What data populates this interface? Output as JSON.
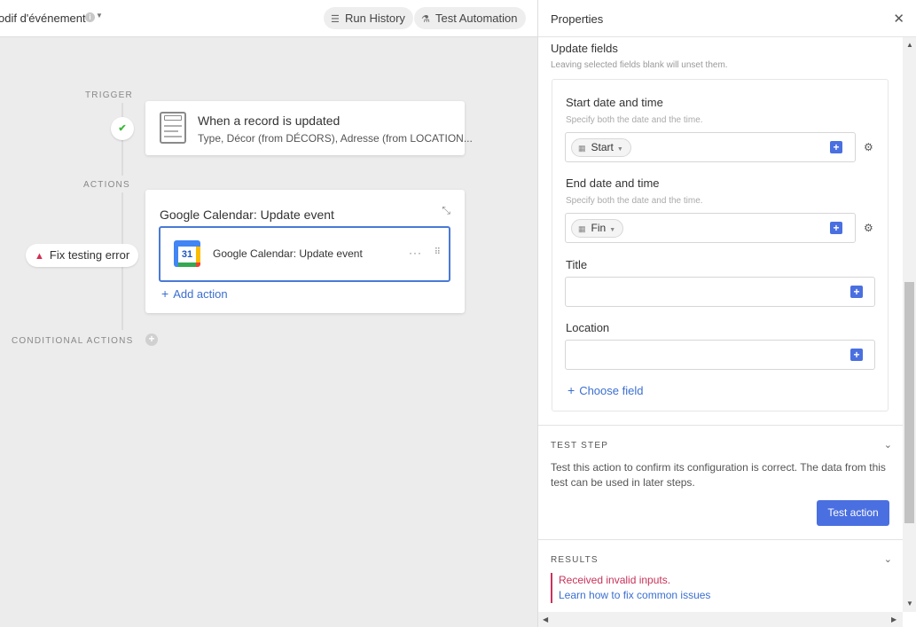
{
  "header": {
    "automation_name": "odif d'événement",
    "run_history_label": "Run History",
    "test_automation_label": "Test Automation"
  },
  "canvas": {
    "trigger_label": "TRIGGER",
    "actions_label": "ACTIONS",
    "conditional_label": "CONDITIONAL ACTIONS",
    "trigger_card": {
      "title": "When a record is updated",
      "subtitle": "Type, Décor (from DÉCORS), Adresse (from LOCATION..."
    },
    "action_card": {
      "title": "Google Calendar: Update event",
      "step_label": "Google Calendar: Update event",
      "calendar_day": "31",
      "add_action_label": "Add action"
    },
    "error_pill": "Fix testing error"
  },
  "panel": {
    "title": "Properties",
    "update_fields_title": "Update fields",
    "update_fields_sub": "Leaving selected fields blank will unset them.",
    "fields": {
      "start": {
        "label": "Start date and time",
        "hint": "Specify both the date and the time.",
        "token": "Start"
      },
      "end": {
        "label": "End date and time",
        "hint": "Specify both the date and the time.",
        "token": "Fin"
      },
      "title": {
        "label": "Title"
      },
      "location": {
        "label": "Location"
      }
    },
    "choose_field_label": "Choose field",
    "test_step": {
      "title": "TEST STEP",
      "description": "Test this action to confirm its configuration is correct. The data from this test can be used in later steps.",
      "button_label": "Test action"
    },
    "results": {
      "title": "RESULTS",
      "error_text": "Received invalid inputs.",
      "link_text": "Learn how to fix common issues"
    }
  },
  "colors": {
    "accent_blue": "#4a6fe0",
    "link_blue": "#3b6fd0",
    "error_red": "#c8325a",
    "success_green": "#3fb93f"
  }
}
